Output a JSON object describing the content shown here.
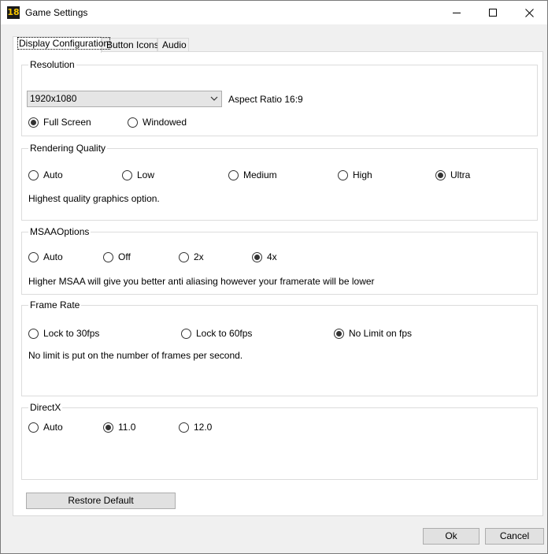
{
  "window": {
    "icon_text": "18",
    "title": "Game Settings"
  },
  "tabs": [
    {
      "label": "Display Configuration",
      "active": true
    },
    {
      "label": "Button Icons",
      "active": false
    },
    {
      "label": "Audio",
      "active": false
    }
  ],
  "resolution": {
    "title": "Resolution",
    "selected": "1920x1080",
    "aspect_label": "Aspect Ratio 16:9",
    "modes": [
      {
        "label": "Full Screen",
        "checked": true
      },
      {
        "label": "Windowed",
        "checked": false
      }
    ]
  },
  "rendering_quality": {
    "title": "Rendering Quality",
    "options": [
      {
        "label": "Auto",
        "checked": false
      },
      {
        "label": "Low",
        "checked": false
      },
      {
        "label": "Medium",
        "checked": false
      },
      {
        "label": "High",
        "checked": false
      },
      {
        "label": "Ultra",
        "checked": true
      }
    ],
    "description": "Highest quality graphics option."
  },
  "msaa": {
    "title": "MSAAOptions",
    "options": [
      {
        "label": "Auto",
        "checked": false
      },
      {
        "label": "Off",
        "checked": false
      },
      {
        "label": "2x",
        "checked": false
      },
      {
        "label": "4x",
        "checked": true
      }
    ],
    "description": "Higher MSAA will give you better anti aliasing however your framerate will be lower"
  },
  "frame_rate": {
    "title": "Frame Rate",
    "options": [
      {
        "label": "Lock  to 30fps",
        "checked": false
      },
      {
        "label": "Lock to 60fps",
        "checked": false
      },
      {
        "label": "No Limit on fps",
        "checked": true
      }
    ],
    "description": "No limit is put on the number of frames per second."
  },
  "directx": {
    "title": "DirectX",
    "options": [
      {
        "label": "Auto",
        "checked": false
      },
      {
        "label": "11.0",
        "checked": true
      },
      {
        "label": "12.0",
        "checked": false
      }
    ]
  },
  "buttons": {
    "restore_default": "Restore Default",
    "ok": "Ok",
    "cancel": "Cancel"
  }
}
